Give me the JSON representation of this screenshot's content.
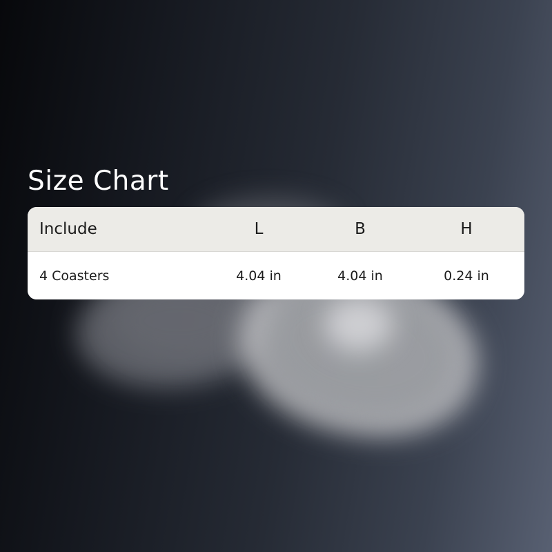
{
  "title": "Size Chart",
  "table": {
    "headers": {
      "include": "Include",
      "l": "L",
      "b": "B",
      "h": "H"
    },
    "rows": [
      {
        "include": "4 Coasters",
        "l": "4.04 in",
        "b": "4.04 in",
        "h": "0.24 in"
      }
    ]
  },
  "colors": {
    "header_bg": "#ecebe7",
    "row_bg": "#ffffff",
    "title_text": "#ffffff",
    "table_text": "#1b1b1b"
  }
}
